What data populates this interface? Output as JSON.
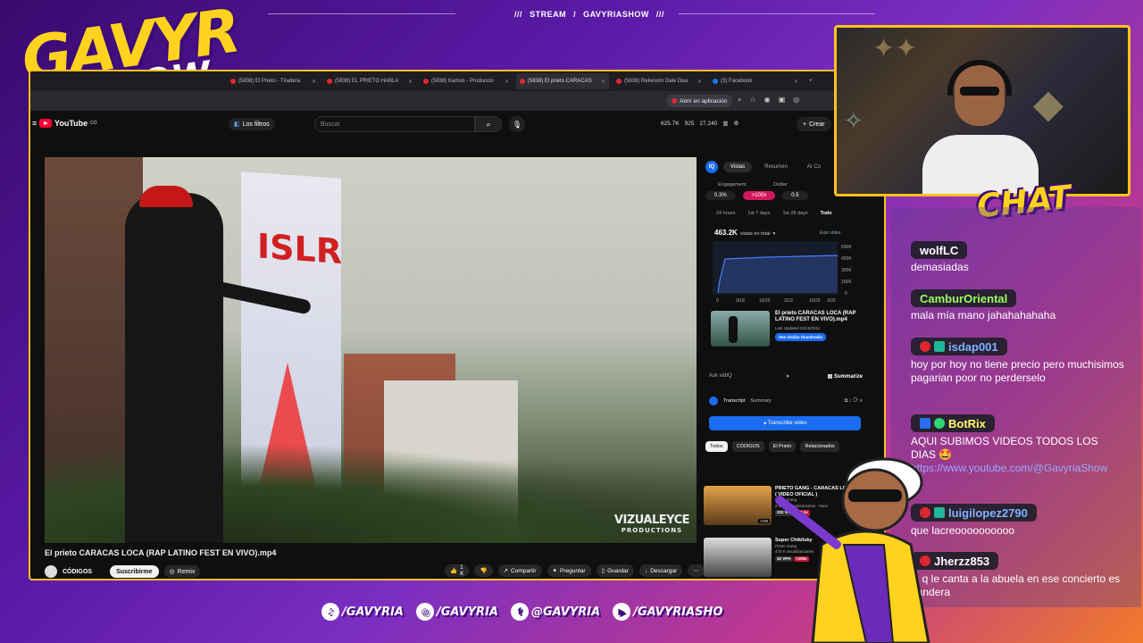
{
  "overlay": {
    "stream_label": "STREAM",
    "channel_label": "GAVYRIASHOW",
    "separator": "///",
    "logo_line1": "GAVYR",
    "logo_line2": "SHOW",
    "chat_title": "CHAT",
    "socials": [
      {
        "icon": "tiktok-icon",
        "label": "/GAVYRIA"
      },
      {
        "icon": "instagram-icon",
        "label": "/GAVYRIA"
      },
      {
        "icon": "facebook-icon",
        "label": "@GAVYRIA"
      },
      {
        "icon": "youtube-icon",
        "label": "/GAVYRIASHO"
      }
    ]
  },
  "browser": {
    "tabs": [
      {
        "label": "(5838) El Prieto - Tiradera",
        "active": false
      },
      {
        "label": "(5838) EL PRIETO HABLA",
        "active": false
      },
      {
        "label": "(5838) Kamus - Produccio",
        "active": false
      },
      {
        "label": "(5838) El prieto CARACAS",
        "active": true
      },
      {
        "label": "(5838) Rekesom Dale Dea",
        "active": false
      },
      {
        "label": "(3) Facebook",
        "active": false
      }
    ],
    "open_in_app": "Abrir en aplicación"
  },
  "youtube": {
    "logo_text": "YouTube",
    "logo_region": "CO",
    "filters_label": "Los filtros",
    "search_placeholder": "Buscar",
    "stats": [
      "625.7K",
      "925",
      "27,240"
    ],
    "create_label": "Crear",
    "video_title": "El prieto CARACAS LOCA (RAP LATINO FEST EN VIVO).mp4",
    "channel_name": "CÓDIGOS",
    "subscribe_label": "Suscribirme",
    "remix_label": "Remix",
    "like_count": "1 K",
    "share_label": "Compartir",
    "ask_label": "Preguntar",
    "save_label": "Guardar",
    "download_label": "Descargar",
    "watermark_main": "VIZUALEYCE",
    "watermark_sub": "PRODUCTIONS"
  },
  "vidiq": {
    "badge": "IQ",
    "tabs": [
      "Vistas",
      "Resumen",
      "AI Co"
    ],
    "metric_labels": [
      "Engagement",
      "Outlier"
    ],
    "engagement": "0.3%",
    "outlier": ">100x",
    "extra": "0.5",
    "periods": [
      "24 hours",
      "1st 7 days",
      "1st 28 days",
      "Todo"
    ],
    "views_total": "463.2K",
    "views_caption": "vistas en total",
    "views_tag": "Este video",
    "chart_y_ticks": [
      "600K",
      "450K",
      "300K",
      "150K",
      "0"
    ],
    "chart_x_ticks": [
      "0",
      "3/18",
      "10/20",
      "3/23",
      "10/25",
      "3/26"
    ],
    "card_title": "El prieto CARACAS LOCA (RAP LATINO FEST EN VIVO).mp4",
    "card_updated": "Last Updated 03/16/2011",
    "card_button": "See similar thumbnails",
    "ask_placeholder": "Ask vidIQ",
    "summarize_label": "Summarize",
    "transcript_tabs": [
      "Transcript",
      "Summary"
    ],
    "transcribe_button": "Transcribe video",
    "related_tabs": [
      "Todos",
      "CÓDIGOS",
      "El Prieto",
      "Relacionados"
    ]
  },
  "recommendations": [
    {
      "title": "PRIETO GANG - CARACAS LOCA ( VIDEO OFICIAL )",
      "channel": "Prieto Gang",
      "meta": "2 M de visualizaciones · hace",
      "vph": "222 VPH",
      "mult": "12.1x",
      "duration": "3:06"
    },
    {
      "title": "Super Chikiluky",
      "channel": "Prieto Gang",
      "meta": "470 K visualizaciones",
      "vph": "32 VPH",
      "mult": ">100x",
      "duration": ""
    }
  ],
  "chat": [
    {
      "user": "wolfLC",
      "color": "#ffffff",
      "text": "demasiadas",
      "icons": []
    },
    {
      "user": "CamburOriental",
      "color": "#9cff5a",
      "text": "mala mía mano jahahahahaha",
      "icons": []
    },
    {
      "user": "isdap001",
      "color": "#7fb3ff",
      "text": "hoy por hoy no tiene precio pero muchisimos pagarian poor no perderselo",
      "icons": [
        "r",
        "g"
      ]
    },
    {
      "user": "BotRix",
      "color": "#ffff66",
      "text": "AQUI SUBIMOS VIDEOS TODOS LOS DIAS 🤩",
      "link": "https://www.youtube.com/@GavyriaShow",
      "icons": [
        "b",
        "check"
      ]
    },
    {
      "user": "luigilopez2790",
      "color": "#7fb3ff",
      "text": "que lacreoooooooooo",
      "icons": [
        "r",
        "g"
      ]
    },
    {
      "user": "Jherzz853",
      "color": "#ffffff",
      "text": "la q le canta a la abuela en ese concierto es bandera",
      "icons": [
        "r"
      ]
    }
  ]
}
